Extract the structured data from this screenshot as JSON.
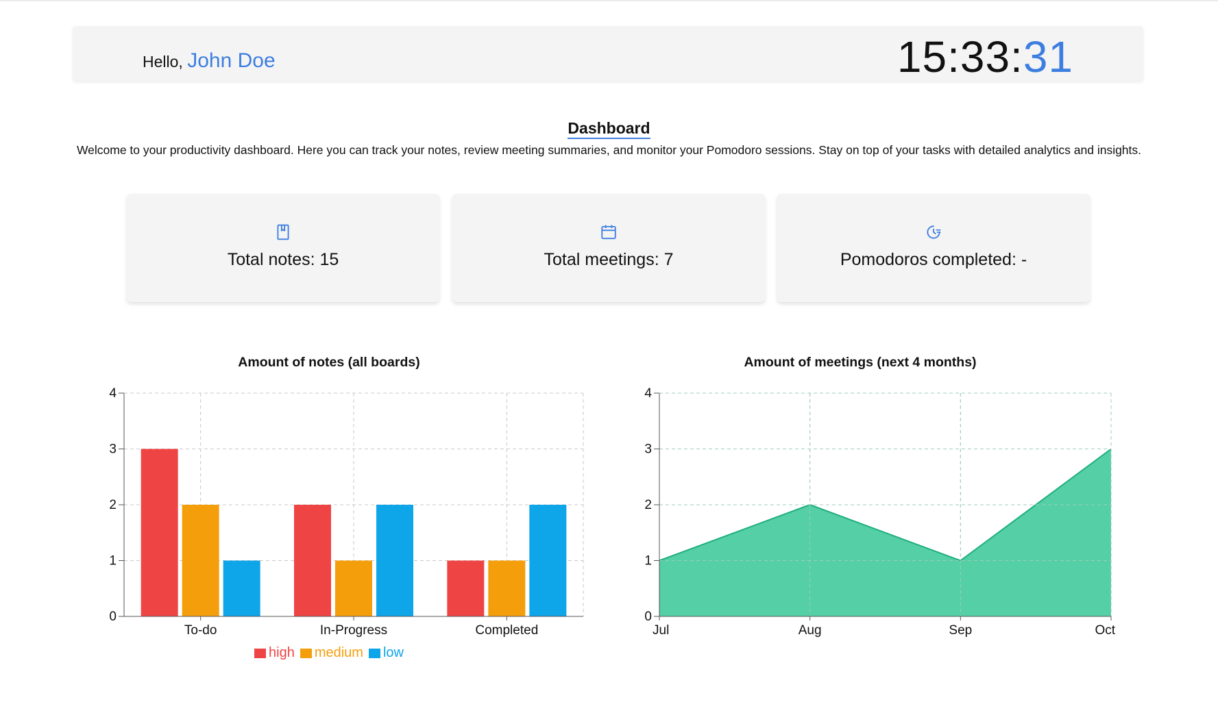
{
  "header": {
    "greeting": "Hello,",
    "user_name": "John Doe",
    "clock_hm": "15:33:",
    "clock_sec": "31"
  },
  "dashboard": {
    "title": "Dashboard",
    "description": "Welcome to your productivity dashboard. Here you can track your notes, review meeting summaries, and monitor your Pomodoro sessions. Stay on top of your tasks with detailed analytics and insights."
  },
  "stats": [
    {
      "icon": "notebook-icon",
      "label": "Total notes: 15"
    },
    {
      "icon": "calendar-icon",
      "label": "Total meetings: 7"
    },
    {
      "icon": "clock-timer-icon",
      "label": "Pomodoros completed: -"
    }
  ],
  "colors": {
    "accent": "#3d7ee0",
    "high": "#ef4444",
    "medium": "#f59e0b",
    "low": "#0ea5e9",
    "area_fill": "#55cfa5",
    "area_stroke": "#1fae7e"
  },
  "chart_data": [
    {
      "type": "bar",
      "title": "Amount of notes (all boards)",
      "categories": [
        "To-do",
        "In-Progress",
        "Completed"
      ],
      "series": [
        {
          "name": "high",
          "values": [
            3,
            2,
            1
          ]
        },
        {
          "name": "medium",
          "values": [
            2,
            1,
            1
          ]
        },
        {
          "name": "low",
          "values": [
            1,
            2,
            2
          ]
        }
      ],
      "ylim": [
        0,
        4
      ],
      "yticks": [
        0,
        1,
        2,
        3,
        4
      ],
      "grid": true,
      "legend": "bottom"
    },
    {
      "type": "area",
      "title": "Amount of meetings (next 4 months)",
      "x": [
        "Jul",
        "Aug",
        "Sep",
        "Oct"
      ],
      "values": [
        1,
        2,
        1,
        3
      ],
      "ylim": [
        0,
        4
      ],
      "yticks": [
        0,
        1,
        2,
        3,
        4
      ],
      "grid": true
    }
  ]
}
